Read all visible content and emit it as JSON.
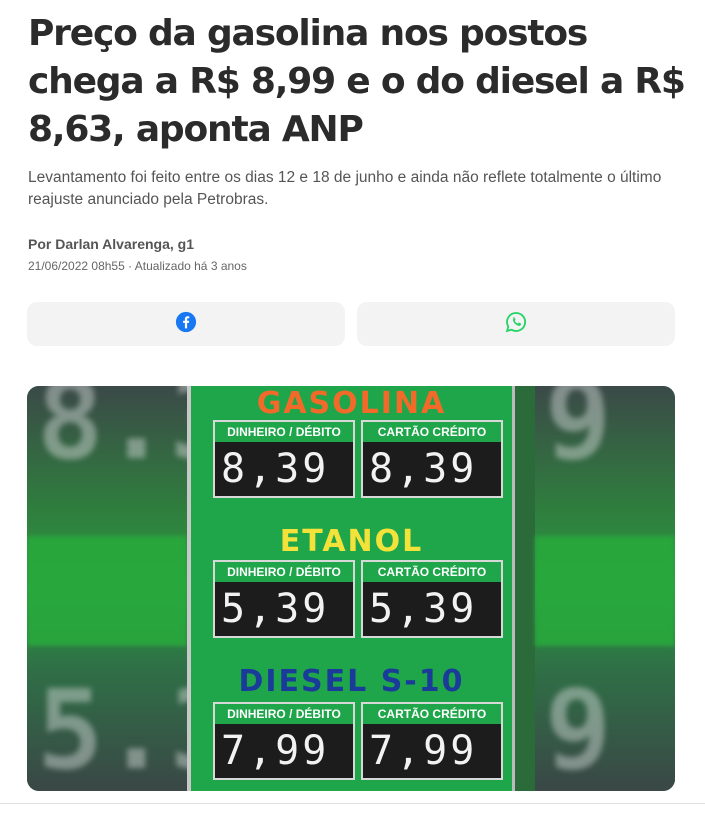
{
  "article": {
    "headline": "Preço da gasolina nos postos chega a R$ 8,99 e o do diesel a R$ 8,63, aponta ANP",
    "subtitle": "Levantamento foi feito entre os dias 12 e 18 de junho e ainda não reflete totalmente o último reajuste anunciado pela Petrobras.",
    "byline": "Por Darlan Alvarenga, g1",
    "dateline": "21/06/2022 08h55 · Atualizado há 3 anos"
  },
  "share": {
    "facebook_icon": "facebook-icon",
    "whatsapp_icon": "whatsapp-icon",
    "facebook_color": "#1877f2",
    "whatsapp_color": "#25d366"
  },
  "photo": {
    "fuels": [
      {
        "name": "GASOLINA",
        "col1_label": "DINHEIRO / DÉBITO",
        "col2_label": "CARTÃO CRÉDITO",
        "col1_price": "8,39",
        "col2_price": "8,39"
      },
      {
        "name": "ETANOL",
        "col1_label": "DINHEIRO / DÉBITO",
        "col2_label": "CARTÃO CRÉDITO",
        "col1_price": "5,39",
        "col2_price": "5,39"
      },
      {
        "name": "DIESEL S-10",
        "col1_label": "DINHEIRO / DÉBITO",
        "col2_label": "CARTÃO CRÉDITO",
        "col1_price": "7,99",
        "col2_price": "7,99"
      }
    ]
  }
}
